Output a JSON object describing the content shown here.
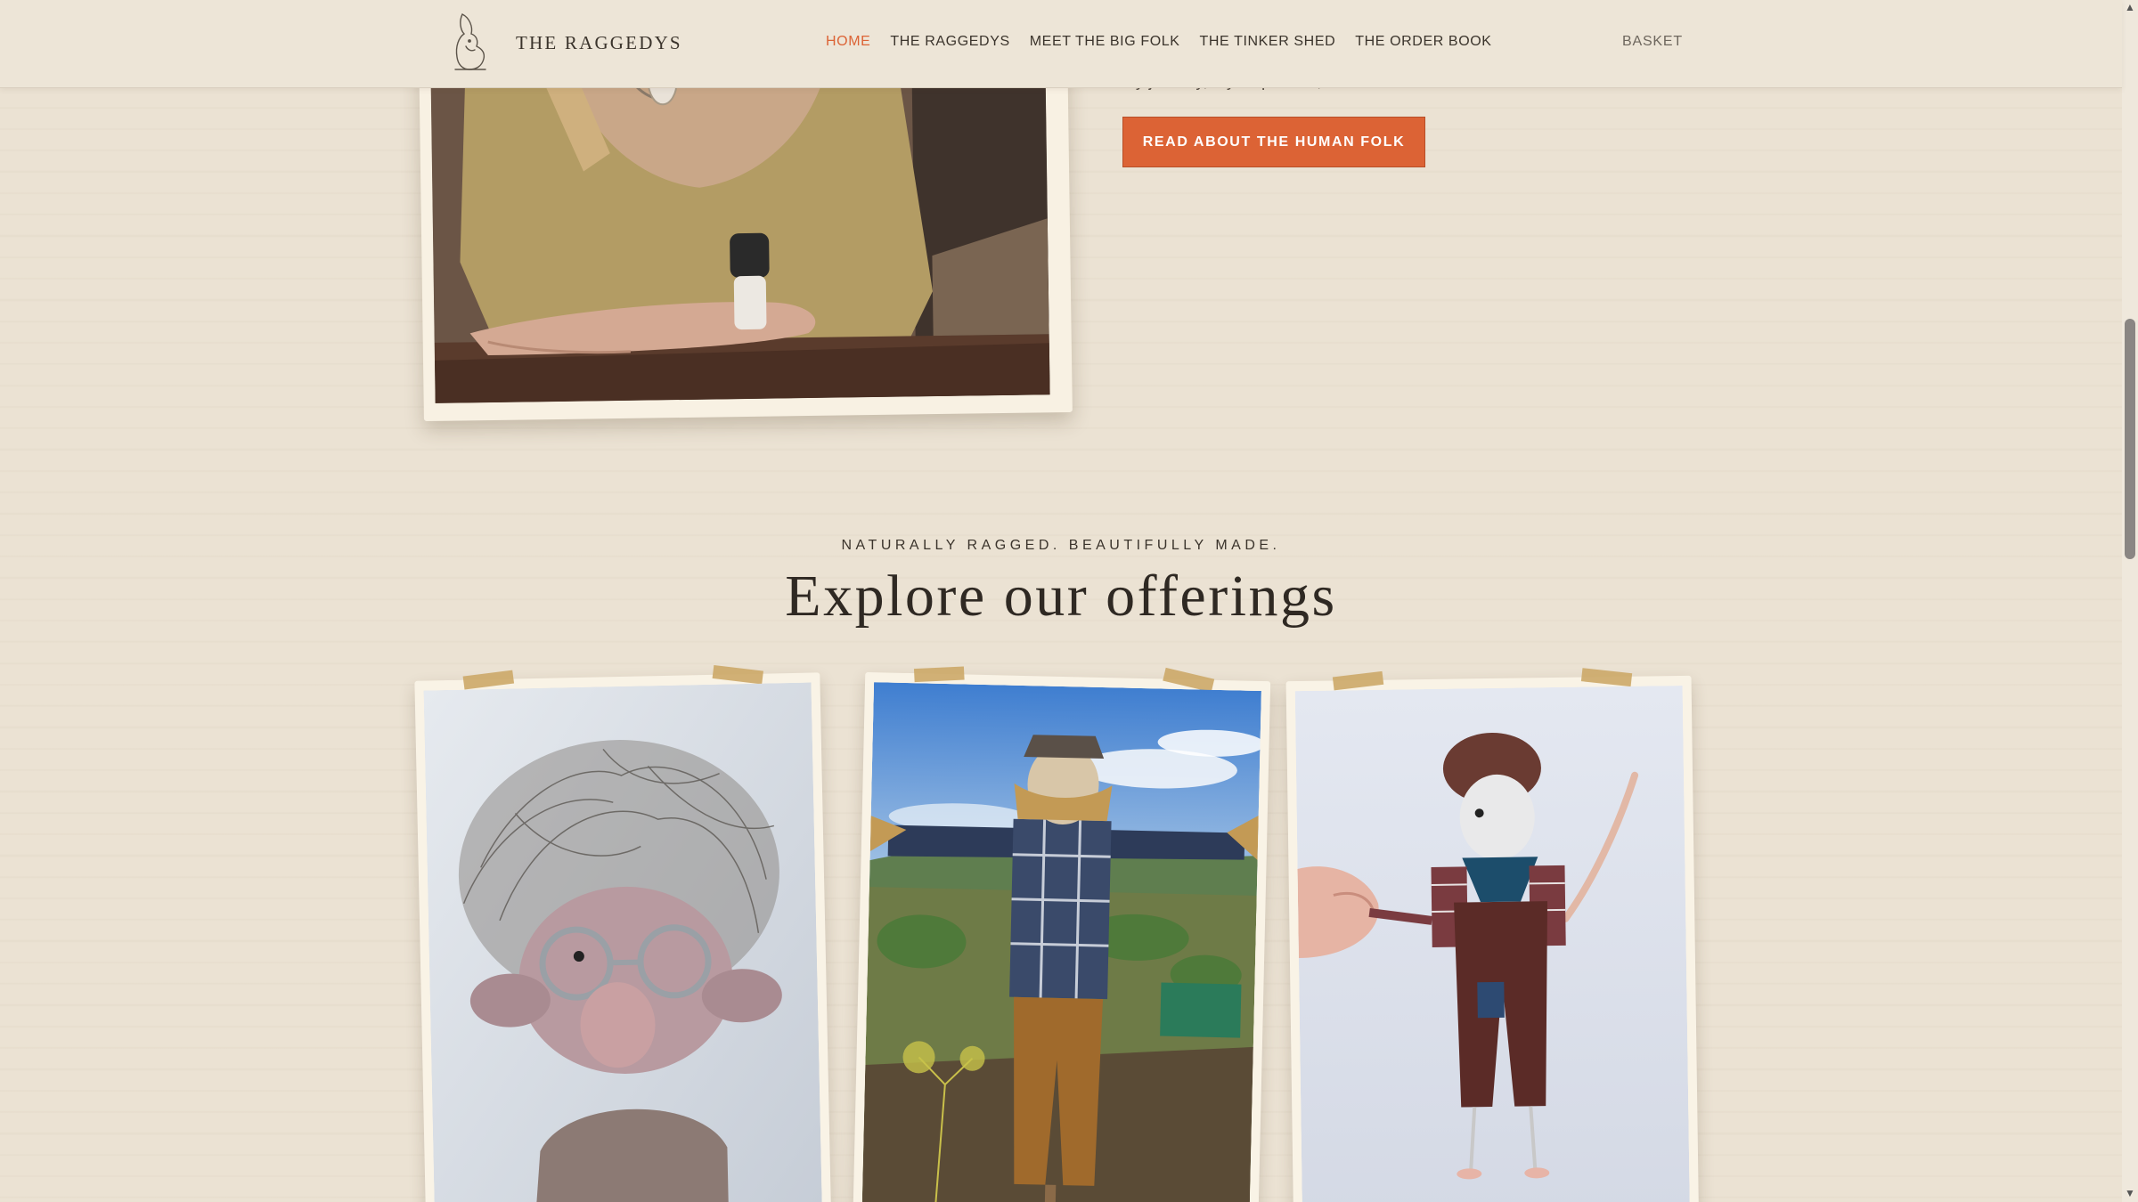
{
  "header": {
    "brand": "THE RAGGEDYS",
    "nav": [
      {
        "label": "HOME",
        "active": true
      },
      {
        "label": "THE RAGGEDYS",
        "active": false
      },
      {
        "label": "MEET THE BIG FOLK",
        "active": false
      },
      {
        "label": "THE TINKER SHED",
        "active": false
      },
      {
        "label": "THE ORDER BOOK",
        "active": false
      }
    ],
    "basket_label": "BASKET"
  },
  "about": {
    "text": "My journey, my inspiration, and the creative heart behind it all.",
    "button_label": "READ ABOUT THE HUMAN FOLK"
  },
  "offerings": {
    "eyebrow": "NATURALLY RAGGED. BEAUTIFULLY MADE.",
    "title": "Explore our offerings"
  },
  "colors": {
    "accent": "#dc6335",
    "background": "#ebe2d3",
    "tape": "#cca868",
    "text_dark": "#2f2923"
  },
  "icons": {
    "logo": "rabbit-figure-logo",
    "scroll_up": "triangle-up-icon",
    "scroll_down": "triangle-down-icon"
  }
}
